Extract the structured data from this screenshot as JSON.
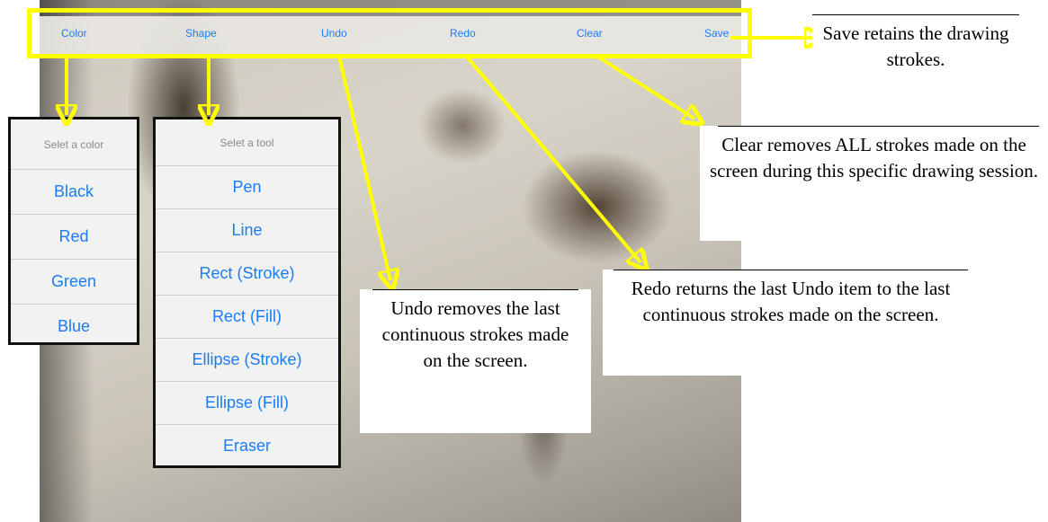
{
  "toolbar": {
    "color": "Color",
    "shape": "Shape",
    "undo": "Undo",
    "redo": "Redo",
    "clear": "Clear",
    "save": "Save"
  },
  "color_panel": {
    "header": "Selet a color",
    "options": [
      "Black",
      "Red",
      "Green",
      "Blue"
    ]
  },
  "tool_panel": {
    "header": "Selet a tool",
    "options": [
      "Pen",
      "Line",
      "Rect (Stroke)",
      "Rect (Fill)",
      "Ellipse (Stroke)",
      "Ellipse (Fill)",
      "Eraser"
    ]
  },
  "annotations": {
    "save": "Save retains the drawing strokes.",
    "clear": "Clear removes ALL strokes made on the screen during this specific drawing session.",
    "redo": "Redo returns the last Undo item to the last continuous strokes made on the screen.",
    "undo": "Undo removes the last continuous strokes made on the screen."
  },
  "colors": {
    "highlight": "#ffff00",
    "link": "#1a7cf5"
  }
}
